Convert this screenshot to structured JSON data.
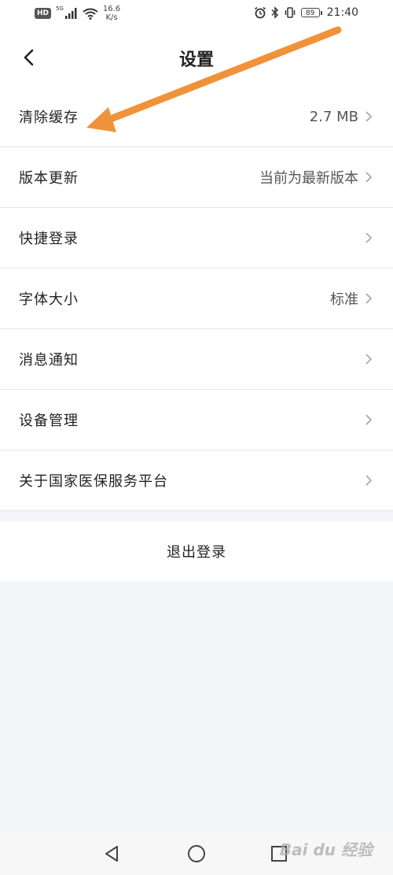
{
  "status_bar": {
    "hd": "HD",
    "network": "5G",
    "speed_value": "16.6",
    "speed_unit": "K/s",
    "battery": "89",
    "time": "21:40"
  },
  "header": {
    "title": "设置"
  },
  "settings": {
    "items": [
      {
        "label": "清除缓存",
        "value": "2.7 MB"
      },
      {
        "label": "版本更新",
        "value": "当前为最新版本"
      },
      {
        "label": "快捷登录",
        "value": ""
      },
      {
        "label": "字体大小",
        "value": "标准"
      },
      {
        "label": "消息通知",
        "value": ""
      },
      {
        "label": "设备管理",
        "value": ""
      },
      {
        "label": "关于国家医保服务平台",
        "value": ""
      }
    ]
  },
  "logout": {
    "label": "退出登录"
  },
  "watermark": {
    "text": "Bai du 经验"
  },
  "colors": {
    "accent_arrow": "#f0923a",
    "background": "#f4f5f9",
    "row_background": "#ffffff",
    "divider": "#e6e6e6"
  },
  "icons": [
    "back-arrow-icon",
    "chevron-right-icon",
    "nav-back-icon",
    "nav-home-icon",
    "nav-recent-icon",
    "alarm-icon",
    "bluetooth-icon",
    "vibrate-icon",
    "wifi-icon",
    "signal-icon"
  ]
}
